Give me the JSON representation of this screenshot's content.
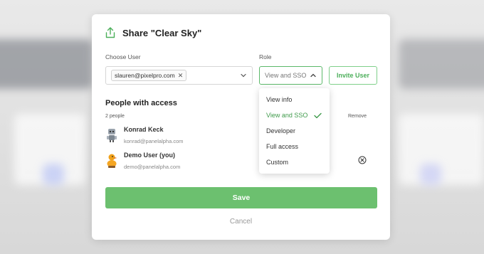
{
  "modal": {
    "title": "Share \"Clear Sky\"",
    "icon": "share-upload-icon",
    "accent_color": "#6cc06f"
  },
  "choose_user": {
    "label": "Choose User",
    "selected_chip": "slauren@pixelpro.com",
    "chip_remove_glyph": "✕"
  },
  "role": {
    "label": "Role",
    "selected": "View and SSO",
    "options": [
      {
        "label": "View info",
        "selected": false
      },
      {
        "label": "View and SSO",
        "selected": true
      },
      {
        "label": "Developer",
        "selected": false
      },
      {
        "label": "Full access",
        "selected": false
      },
      {
        "label": "Custom",
        "selected": false
      }
    ]
  },
  "invite_button": {
    "label": "Invite User"
  },
  "people": {
    "title": "People with access",
    "count": "2 people",
    "remove_header": "Remove",
    "list": [
      {
        "name": "Konrad Keck",
        "email": "konrad@panelalpha.com",
        "avatar": "robot-avatar",
        "removable": false
      },
      {
        "name": "Demo User (you)",
        "email": "demo@panelalpha.com",
        "avatar": "duck-avatar",
        "removable": true
      }
    ]
  },
  "actions": {
    "save": "Save",
    "cancel": "Cancel"
  }
}
